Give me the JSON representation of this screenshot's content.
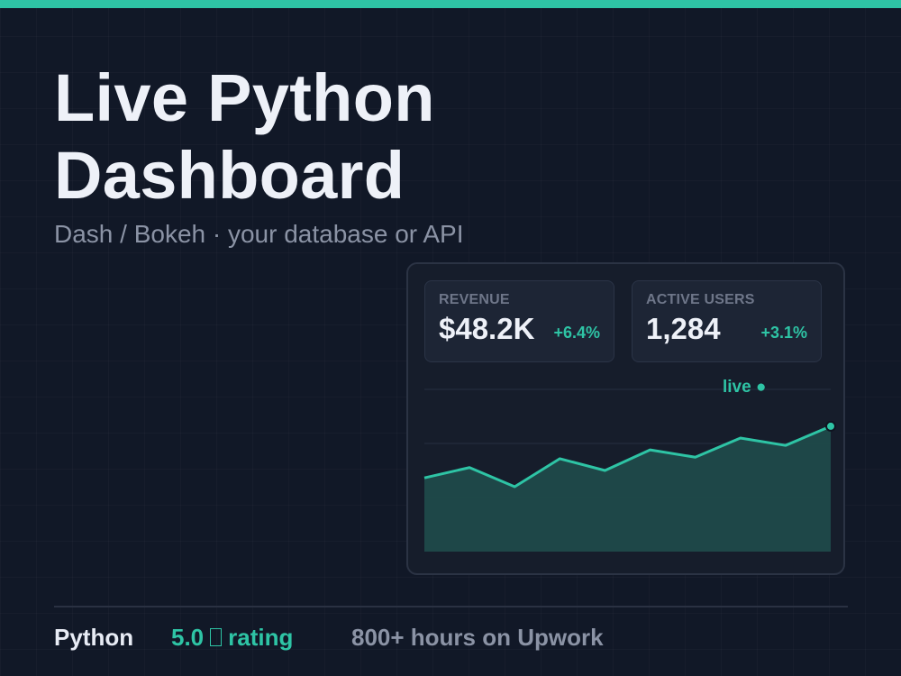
{
  "colors": {
    "accent": "#2ec4a5",
    "background": "#111827",
    "card": "#161d2b",
    "kpi_card": "#1d2535",
    "muted_text": "#8b93a5",
    "area_fill": "#1f4a4a"
  },
  "hero": {
    "title_line1": "Live Python",
    "title_line2": "Dashboard",
    "subtitle": "Dash / Bokeh · your database or API"
  },
  "dashboard": {
    "kpis": [
      {
        "label": "REVENUE",
        "value": "$48.2K",
        "delta": "+6.4%"
      },
      {
        "label": "ACTIVE USERS",
        "value": "1,284",
        "delta": "+3.1%"
      }
    ],
    "live_label": "live ●"
  },
  "chart_data": {
    "type": "area",
    "x": [
      1,
      2,
      3,
      4,
      5,
      6,
      7,
      8,
      9,
      10
    ],
    "series": [
      {
        "values": [
          30,
          37,
          24,
          43,
          35,
          49,
          44,
          57,
          52,
          65
        ]
      }
    ],
    "ylim": [
      -20,
      90
    ],
    "grid": true,
    "last_point_highlighted": true,
    "title": "",
    "xlabel": "",
    "ylabel": ""
  },
  "footer": {
    "language": "Python",
    "rating_value": "5.0",
    "star_icon": "star-icon",
    "rating_label": "rating",
    "hours": "800+ hours on Upwork"
  }
}
